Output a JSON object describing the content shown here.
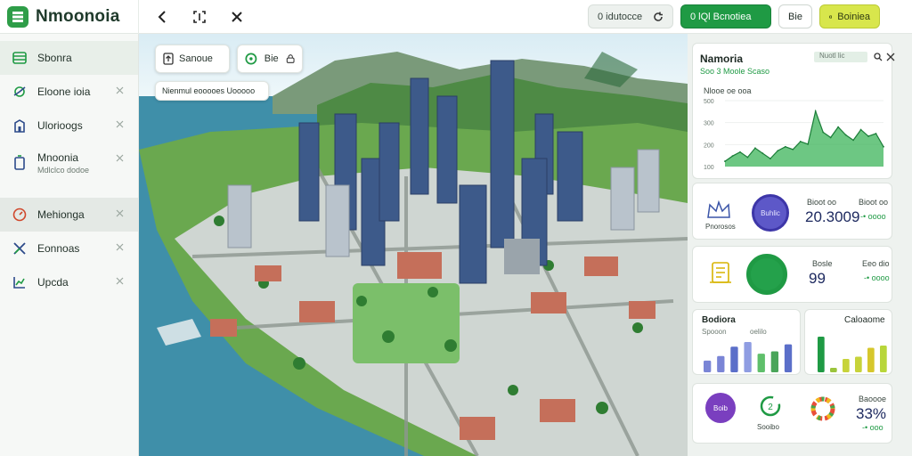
{
  "app": {
    "title": "Nmoonoia"
  },
  "topbar": {
    "btn_search_label": "0 idutocce",
    "btn_primary_label": "0 lQl  Bcnotiea",
    "btn_small_label": "Bie",
    "btn_lime_label": "Boiniea"
  },
  "sidebar": {
    "items": [
      {
        "label": "Sbonra",
        "icon": "layers-icon"
      },
      {
        "label": "Eloone ioia",
        "icon": "route-icon"
      },
      {
        "label": "Ulorioogs",
        "icon": "building-icon"
      },
      {
        "label": "Mnoonia",
        "sub": "Mdlclco dodoe",
        "icon": "device-icon"
      },
      {
        "label": "Mehionga",
        "icon": "gauge-icon"
      },
      {
        "label": "Eonnoas",
        "icon": "cross-icon"
      },
      {
        "label": "Upcda",
        "icon": "chart-icon"
      }
    ]
  },
  "map": {
    "chip1_label": "Sanoue",
    "chip2_label": "Bie",
    "tooltip_label": "Nienmul eooooes Uooooo"
  },
  "panel": {
    "chart_card": {
      "title": "Namoria",
      "subtitle": "Soo 3 Moole Scaso",
      "right_label": "Nuotl lic",
      "left_label": "Nlooe oe ooa"
    },
    "stat_card": {
      "circle_label": "Buhlic",
      "caption": "Pnorosos",
      "value": "20.3009",
      "right_label": "Bioot oo",
      "right_value": "-• oooo"
    },
    "progress_card": {
      "label": "Bosle",
      "value": "99",
      "right_label": "Eeo dio",
      "right_value": "-• oooo"
    },
    "bars_left": {
      "title": "Bodiora",
      "sub1": "Spooon",
      "sub2": "oelilo"
    },
    "bars_right": {
      "title": "Caloaome"
    },
    "bottom_card": {
      "circle_label": "Boib",
      "caption": "Sooibo",
      "right_label": "Baoooe",
      "value": "33%",
      "right_value": "-• ooo"
    }
  },
  "colors": {
    "primary": "#1f9a44",
    "lime": "#d8e64c",
    "purple": "#7a3fbf",
    "water": "#3f8fa9"
  },
  "chart_data": {
    "type": "area",
    "title": "Namoria",
    "subtitle": "Soo 3 Moole Scaso",
    "y_tick_labels": [
      "500",
      "300",
      "200",
      "100"
    ],
    "ylim": [
      0,
      500
    ],
    "series": [
      {
        "values": [
          40,
          80,
          110,
          70,
          140,
          100,
          60,
          120,
          150,
          130,
          190,
          170,
          420,
          260,
          220,
          300,
          240,
          200,
          280,
          230,
          250,
          150
        ]
      }
    ],
    "bars_left": {
      "type": "bar",
      "values": [
        25,
        35,
        55,
        65,
        40,
        45,
        60
      ]
    },
    "bars_right": {
      "type": "bar",
      "values": [
        80,
        10,
        30,
        35,
        55,
        60
      ]
    }
  }
}
